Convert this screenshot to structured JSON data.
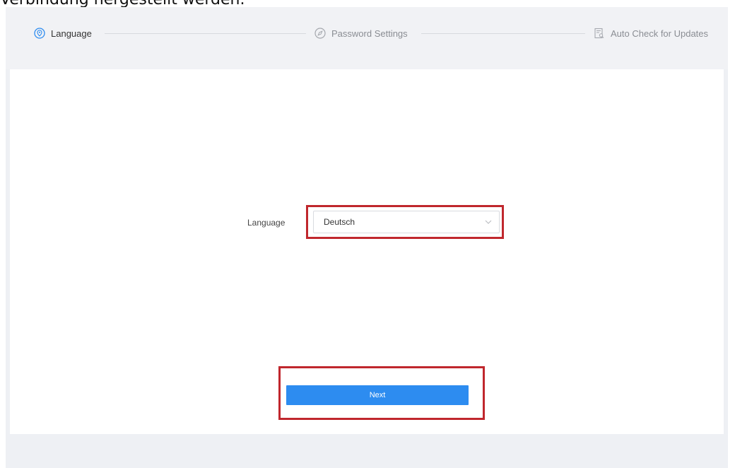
{
  "caption": {
    "text": "Verbindung hergestellt werden."
  },
  "stepper": {
    "steps": [
      {
        "label": "Language",
        "icon": "location-pin-icon",
        "state": "active"
      },
      {
        "label": "Password Settings",
        "icon": "compass-icon",
        "state": "inactive"
      },
      {
        "label": "Auto Check for Updates",
        "icon": "document-search-icon",
        "state": "inactive"
      }
    ]
  },
  "form": {
    "language_label": "Language",
    "language_value": "Deutsch"
  },
  "actions": {
    "next_label": "Next"
  },
  "colors": {
    "accent": "#2d8cf0",
    "highlight_border": "#c0272d",
    "stepper_background": "#f1f2f5"
  }
}
